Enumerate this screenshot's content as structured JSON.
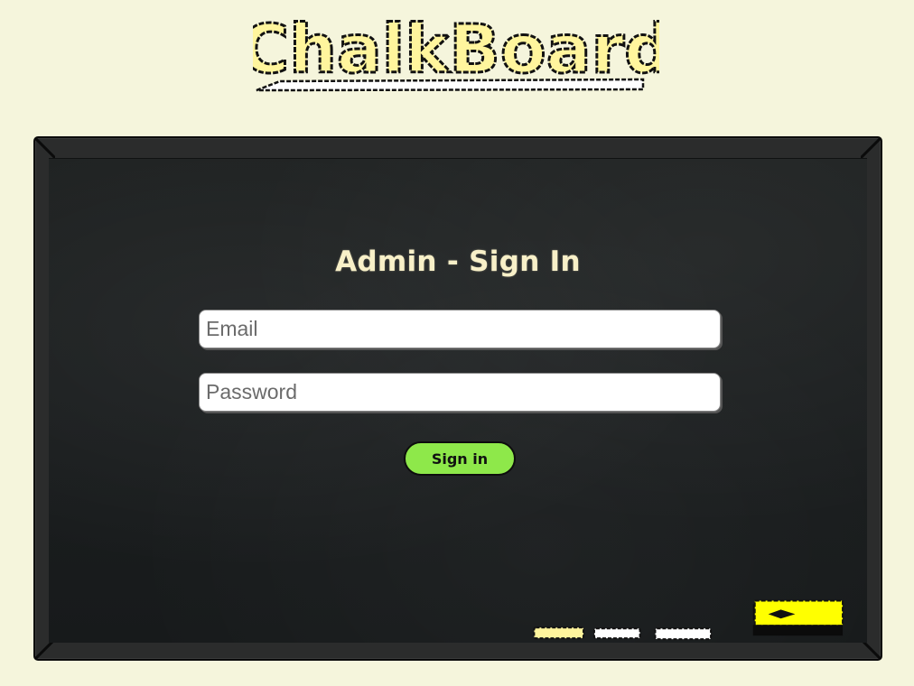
{
  "header": {
    "logo_text": "ChalkBoard",
    "logo_icon": "chalkboard-logo"
  },
  "signin_form": {
    "title": "Admin - Sign In",
    "email_placeholder": "Email",
    "email_value": "",
    "password_placeholder": "Password",
    "password_value": "",
    "submit_label": "Sign in"
  },
  "chalk_tray": {
    "items": [
      {
        "name": "chalk-yellow-icon",
        "color": "#fff59d"
      },
      {
        "name": "chalk-white-icon",
        "color": "#ffffff"
      },
      {
        "name": "chalk-white-icon",
        "color": "#ffffff"
      }
    ],
    "eraser": {
      "name": "eraser-icon",
      "color": "#ffff00"
    }
  },
  "colors": {
    "page_background": "#f5f5dc",
    "board_frame": "#2b2c2c",
    "board_surface": "#1c1f20",
    "title_chalk": "#f8f0c8",
    "submit_button": "#8ee84a",
    "logo_fill": "#fff59d"
  }
}
